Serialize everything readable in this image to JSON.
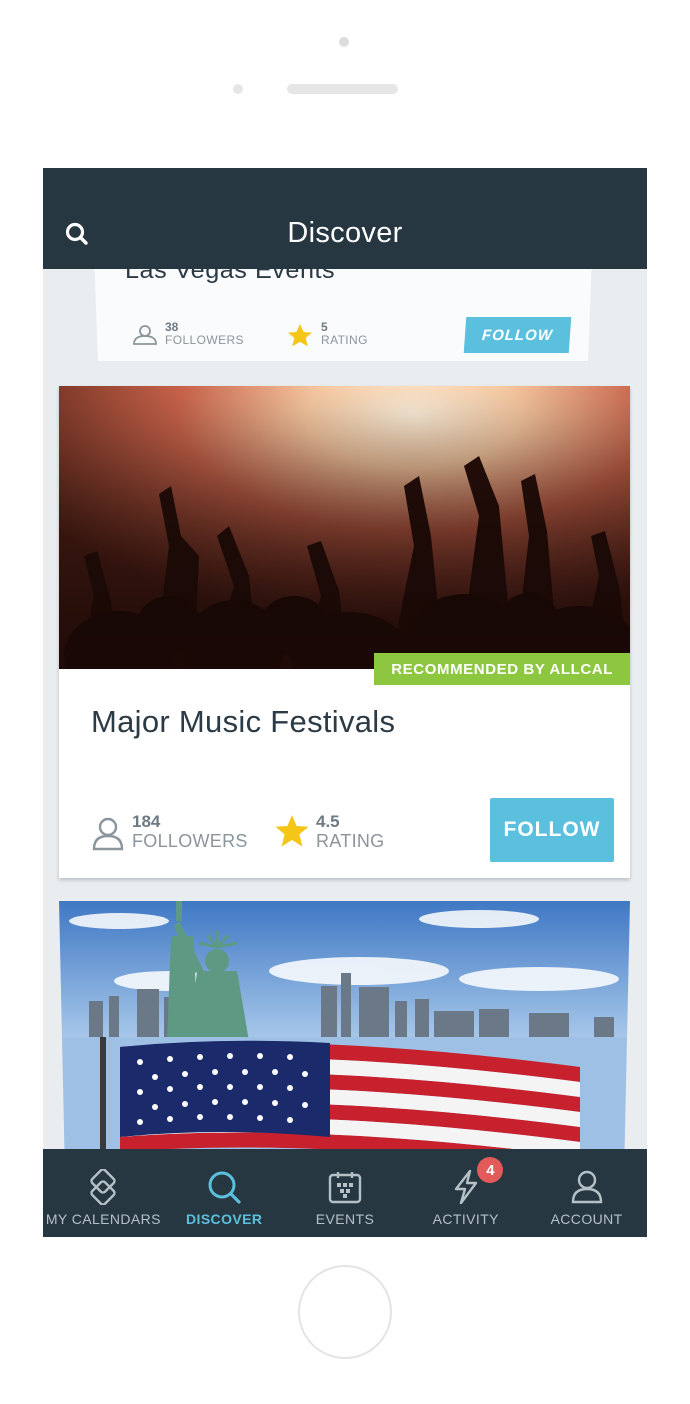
{
  "header": {
    "title": "Discover",
    "search_icon": "search-icon"
  },
  "cards": [
    {
      "title": "Las Vegas Events",
      "followers_count": "38",
      "followers_label": "FOLLOWERS",
      "rating_value": "5",
      "rating_label": "RATING",
      "follow_label": "FOLLOW"
    },
    {
      "title": "Major Music Festivals",
      "badge": "RECOMMENDED BY ALLCAL",
      "followers_count": "184",
      "followers_label": "FOLLOWERS",
      "rating_value": "4.5",
      "rating_label": "RATING",
      "follow_label": "FOLLOW"
    }
  ],
  "tabbar": {
    "tabs": [
      {
        "label": "MY CALENDARS",
        "icon": "calendars-icon",
        "active": false
      },
      {
        "label": "DISCOVER",
        "icon": "search-icon",
        "active": true
      },
      {
        "label": "EVENTS",
        "icon": "calendar-icon",
        "active": false
      },
      {
        "label": "ACTIVITY",
        "icon": "lightning-icon",
        "active": false,
        "badge": "4"
      },
      {
        "label": "ACCOUNT",
        "icon": "user-icon",
        "active": false
      }
    ]
  },
  "colors": {
    "header_bg": "#263741",
    "accent": "#5bc0de",
    "badge_green": "#8dc63f",
    "notification_red": "#e25a5a",
    "star": "#f5c518"
  }
}
